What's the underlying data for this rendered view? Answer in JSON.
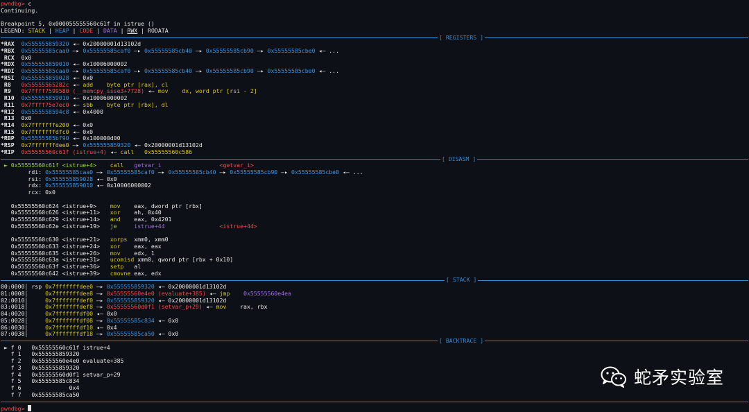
{
  "prompt": "pwndbg>",
  "command": "c",
  "continuing": "Continuing.",
  "breakpoint": "Breakpoint 5, 0x000055555560c61f in istrue ()",
  "legend": {
    "label": "LEGEND:",
    "stack": "STACK",
    "heap": "HEAP",
    "code": "CODE",
    "data": "DATA",
    "rwx": "RWX",
    "rodata": "RODATA"
  },
  "sections": {
    "registers": "[ REGISTERS ]",
    "disasm": "[ DISASM ]",
    "stack": "[ STACK ]",
    "backtrace": "[ BACKTRACE ]"
  },
  "registers": [
    {
      "name": "*RAX",
      "parts": [
        {
          "t": "0x555555859320",
          "c": "blue"
        },
        {
          "t": " ◂— 0x20000001d13102d",
          "c": "white"
        }
      ]
    },
    {
      "name": "*RBX",
      "parts": [
        {
          "t": "0x55555585caa0",
          "c": "blue"
        },
        {
          "t": " —▸ ",
          "c": "white"
        },
        {
          "t": "0x55555585caf0",
          "c": "blue"
        },
        {
          "t": " —▸ ",
          "c": "white"
        },
        {
          "t": "0x55555585cb40",
          "c": "blue"
        },
        {
          "t": " —▸ ",
          "c": "white"
        },
        {
          "t": "0x55555585cb90",
          "c": "blue"
        },
        {
          "t": " —▸ ",
          "c": "white"
        },
        {
          "t": "0x55555585cbe0",
          "c": "blue"
        },
        {
          "t": " ◂— ...",
          "c": "white"
        }
      ]
    },
    {
      "name": " RCX",
      "parts": [
        {
          "t": "0x0",
          "c": "white"
        }
      ]
    },
    {
      "name": "*RDX",
      "parts": [
        {
          "t": "0x555555859010",
          "c": "blue"
        },
        {
          "t": " ◂— 0x10006000002",
          "c": "white"
        }
      ]
    },
    {
      "name": "*RDI",
      "parts": [
        {
          "t": "0x55555585caa0",
          "c": "blue"
        },
        {
          "t": " —▸ ",
          "c": "white"
        },
        {
          "t": "0x55555585caf0",
          "c": "blue"
        },
        {
          "t": " —▸ ",
          "c": "white"
        },
        {
          "t": "0x55555585cb40",
          "c": "blue"
        },
        {
          "t": " —▸ ",
          "c": "white"
        },
        {
          "t": "0x55555585cb90",
          "c": "blue"
        },
        {
          "t": " —▸ ",
          "c": "white"
        },
        {
          "t": "0x55555585cbe0",
          "c": "blue"
        },
        {
          "t": " ◂— ...",
          "c": "white"
        }
      ]
    },
    {
      "name": "*RSI",
      "parts": [
        {
          "t": "0x555555859028",
          "c": "blue"
        },
        {
          "t": " ◂— 0x0",
          "c": "white"
        }
      ]
    },
    {
      "name": " R8 ",
      "parts": [
        {
          "t": "0x55555565282c",
          "c": "red"
        },
        {
          "t": " ◂— ",
          "c": "white"
        },
        {
          "t": "add    byte ptr [rax], cl",
          "c": "yellow"
        }
      ]
    },
    {
      "name": " R9 ",
      "parts": [
        {
          "t": "0x7ffff7599580 (__memcpy_ssse3+7728)",
          "c": "red"
        },
        {
          "t": " ◂— ",
          "c": "white"
        },
        {
          "t": "mov    dx, word ptr [rsi - 2]",
          "c": "yellow"
        }
      ]
    },
    {
      "name": " R10",
      "parts": [
        {
          "t": "0x555555859010",
          "c": "blue"
        },
        {
          "t": " ◂— 0x10006000002",
          "c": "white"
        }
      ]
    },
    {
      "name": " R11",
      "parts": [
        {
          "t": "0x7ffff75e7ec0",
          "c": "red"
        },
        {
          "t": " ◂— ",
          "c": "white"
        },
        {
          "t": "sbb    byte ptr [rbx], dl",
          "c": "yellow"
        }
      ]
    },
    {
      "name": "*R12",
      "parts": [
        {
          "t": "0x5555558594c8",
          "c": "blue"
        },
        {
          "t": " ◂— 0x4000",
          "c": "white"
        }
      ]
    },
    {
      "name": " R13",
      "parts": [
        {
          "t": "0x0",
          "c": "white"
        }
      ]
    },
    {
      "name": "*R14",
      "parts": [
        {
          "t": "0x7fffffffe200",
          "c": "yellow"
        },
        {
          "t": " ◂— 0x0",
          "c": "white"
        }
      ]
    },
    {
      "name": " R15",
      "parts": [
        {
          "t": "0x7fffffffdfc0",
          "c": "yellow"
        },
        {
          "t": " ◂— 0x0",
          "c": "white"
        }
      ]
    },
    {
      "name": "*RBP",
      "parts": [
        {
          "t": "0x55555585bf90",
          "c": "blue"
        },
        {
          "t": " ◂— 0x100000d00",
          "c": "white"
        }
      ]
    },
    {
      "name": "*RSP",
      "parts": [
        {
          "t": "0x7fffffffdee0",
          "c": "yellow"
        },
        {
          "t": " —▸ ",
          "c": "white"
        },
        {
          "t": "0x555555859320",
          "c": "blue"
        },
        {
          "t": " ◂— 0x20000001d13102d",
          "c": "white"
        }
      ]
    },
    {
      "name": "*RIP",
      "parts": [
        {
          "t": "0x55555560c61f (istrue+4)",
          "c": "red"
        },
        {
          "t": " ◂— ",
          "c": "white"
        },
        {
          "t": "call   0x55555560c586",
          "c": "yellow"
        }
      ]
    }
  ],
  "disasm": [
    {
      "parts": [
        {
          "t": " ► 0x55555560c61f <istrue+4>    ",
          "c": "green"
        },
        {
          "t": "call   ",
          "c": "yellow"
        },
        {
          "t": "getvar_i",
          "c": "purple"
        },
        {
          "t": "                 ",
          "c": "white"
        },
        {
          "t": "<getvar_i>",
          "c": "red"
        }
      ]
    },
    {
      "parts": [
        {
          "t": "        rdi: ",
          "c": "white"
        },
        {
          "t": "0x55555585caa0",
          "c": "blue"
        },
        {
          "t": " —▸ ",
          "c": "white"
        },
        {
          "t": "0x55555585caf0",
          "c": "blue"
        },
        {
          "t": " —▸ ",
          "c": "white"
        },
        {
          "t": "0x55555585cb40",
          "c": "blue"
        },
        {
          "t": " —▸ ",
          "c": "white"
        },
        {
          "t": "0x55555585cb90",
          "c": "blue"
        },
        {
          "t": " —▸ ",
          "c": "white"
        },
        {
          "t": "0x55555585cbe0",
          "c": "blue"
        },
        {
          "t": " ◂— ...",
          "c": "white"
        }
      ]
    },
    {
      "parts": [
        {
          "t": "        rsi: ",
          "c": "white"
        },
        {
          "t": "0x555555859028",
          "c": "blue"
        },
        {
          "t": " ◂— 0x0",
          "c": "white"
        }
      ]
    },
    {
      "parts": [
        {
          "t": "        rdx: ",
          "c": "white"
        },
        {
          "t": "0x555555859010",
          "c": "blue"
        },
        {
          "t": " ◂— 0x10006000002",
          "c": "white"
        }
      ]
    },
    {
      "parts": [
        {
          "t": "        rcx: 0x0",
          "c": "white"
        }
      ]
    },
    {
      "parts": [
        {
          "t": " ",
          "c": "white"
        }
      ]
    },
    {
      "parts": [
        {
          "t": "   0x55555560c624 <istrue+9>    ",
          "c": "white"
        },
        {
          "t": "mov    ",
          "c": "yellow"
        },
        {
          "t": "eax, dword ptr [rbx]",
          "c": "white"
        }
      ]
    },
    {
      "parts": [
        {
          "t": "   0x55555560c626 <istrue+11>   ",
          "c": "white"
        },
        {
          "t": "xor    ",
          "c": "yellow"
        },
        {
          "t": "ah, 0x40",
          "c": "white"
        }
      ]
    },
    {
      "parts": [
        {
          "t": "   0x55555560c629 <istrue+14>   ",
          "c": "white"
        },
        {
          "t": "and    ",
          "c": "yellow"
        },
        {
          "t": "eax, 0x4201",
          "c": "white"
        }
      ]
    },
    {
      "parts": [
        {
          "t": "   0x55555560c62e <istrue+19>   ",
          "c": "white"
        },
        {
          "t": "je     ",
          "c": "green"
        },
        {
          "t": "istrue+44",
          "c": "purple"
        },
        {
          "t": "                ",
          "c": "white"
        },
        {
          "t": "<istrue+44>",
          "c": "red"
        }
      ]
    },
    {
      "parts": [
        {
          "t": " ",
          "c": "white"
        }
      ]
    },
    {
      "parts": [
        {
          "t": "   0x55555560c630 <istrue+21>   ",
          "c": "white"
        },
        {
          "t": "xorps  ",
          "c": "yellow"
        },
        {
          "t": "xmm0, xmm0",
          "c": "white"
        }
      ]
    },
    {
      "parts": [
        {
          "t": "   0x55555560c633 <istrue+24>   ",
          "c": "white"
        },
        {
          "t": "xor    ",
          "c": "yellow"
        },
        {
          "t": "eax, eax",
          "c": "white"
        }
      ]
    },
    {
      "parts": [
        {
          "t": "   0x55555560c635 <istrue+26>   ",
          "c": "white"
        },
        {
          "t": "mov    ",
          "c": "yellow"
        },
        {
          "t": "edx, 1",
          "c": "white"
        }
      ]
    },
    {
      "parts": [
        {
          "t": "   0x55555560c63a <istrue+31>   ",
          "c": "white"
        },
        {
          "t": "ucomisd ",
          "c": "yellow"
        },
        {
          "t": "xmm0, qword ptr [rbx + 0x10]",
          "c": "white"
        }
      ]
    },
    {
      "parts": [
        {
          "t": "   0x55555560c63f <istrue+36>   ",
          "c": "white"
        },
        {
          "t": "setp   ",
          "c": "yellow"
        },
        {
          "t": "al",
          "c": "white"
        }
      ]
    },
    {
      "parts": [
        {
          "t": "   0x55555560c642 <istrue+39>   ",
          "c": "white"
        },
        {
          "t": "cmovne ",
          "c": "yellow"
        },
        {
          "t": "eax, edx",
          "c": "white"
        }
      ]
    }
  ],
  "stack": [
    {
      "parts": [
        {
          "t": "00:0000│ ",
          "c": "white"
        },
        {
          "t": "rsp ",
          "c": "white"
        },
        {
          "t": "0x7fffffffdee0",
          "c": "yellow"
        },
        {
          "t": " —▸ ",
          "c": "white"
        },
        {
          "t": "0x555555859320",
          "c": "blue"
        },
        {
          "t": " ◂— 0x20000001d13102d",
          "c": "white"
        }
      ]
    },
    {
      "parts": [
        {
          "t": "01:0008│     ",
          "c": "white"
        },
        {
          "t": "0x7fffffffdee8",
          "c": "yellow"
        },
        {
          "t": " —▸ ",
          "c": "white"
        },
        {
          "t": "0x55555560e4e0 (evaluate+385)",
          "c": "red"
        },
        {
          "t": " ◂— ",
          "c": "white"
        },
        {
          "t": "jmp    ",
          "c": "yellow"
        },
        {
          "t": "0x55555560e4ea",
          "c": "purple"
        }
      ]
    },
    {
      "parts": [
        {
          "t": "02:0010│     ",
          "c": "white"
        },
        {
          "t": "0x7fffffffdef0",
          "c": "yellow"
        },
        {
          "t": " —▸ ",
          "c": "white"
        },
        {
          "t": "0x555555859320",
          "c": "blue"
        },
        {
          "t": " ◂— 0x20000001d13102d",
          "c": "white"
        }
      ]
    },
    {
      "parts": [
        {
          "t": "03:0018│     ",
          "c": "white"
        },
        {
          "t": "0x7fffffffdef8",
          "c": "yellow"
        },
        {
          "t": " —▸ ",
          "c": "white"
        },
        {
          "t": "0x55555560d0f1 (setvar_p+29)",
          "c": "red"
        },
        {
          "t": " ◂— ",
          "c": "white"
        },
        {
          "t": "mov    ",
          "c": "yellow"
        },
        {
          "t": "rax, rbx",
          "c": "white"
        }
      ]
    },
    {
      "parts": [
        {
          "t": "04:0020│     ",
          "c": "white"
        },
        {
          "t": "0x7fffffffdf00",
          "c": "yellow"
        },
        {
          "t": " ◂— 0x0",
          "c": "white"
        }
      ]
    },
    {
      "parts": [
        {
          "t": "05:0028│     ",
          "c": "white"
        },
        {
          "t": "0x7fffffffdf08",
          "c": "yellow"
        },
        {
          "t": " —▸ ",
          "c": "white"
        },
        {
          "t": "0x55555585c834",
          "c": "blue"
        },
        {
          "t": " ◂— 0x0",
          "c": "white"
        }
      ]
    },
    {
      "parts": [
        {
          "t": "06:0030│     ",
          "c": "white"
        },
        {
          "t": "0x7fffffffdf10",
          "c": "yellow"
        },
        {
          "t": " ◂— 0x4",
          "c": "white"
        }
      ]
    },
    {
      "parts": [
        {
          "t": "07:0038│     ",
          "c": "white"
        },
        {
          "t": "0x7fffffffdf18",
          "c": "yellow"
        },
        {
          "t": " —▸ ",
          "c": "white"
        },
        {
          "t": "0x55555585ca50",
          "c": "blue"
        },
        {
          "t": " ◂— 0x0",
          "c": "white"
        }
      ]
    }
  ],
  "backtrace": [
    " ► f 0   0x55555560c61f istrue+4",
    "   f 1   0x555555859320",
    "   f 2   0x55555560e4e0 evaluate+385",
    "   f 3   0x555555859320",
    "   f 4   0x55555560d0f1 setvar_p+29",
    "   f 5   0x55555585c834",
    "   f 6              0x4",
    "   f 7   0x55555585ca50"
  ],
  "watermark": {
    "text": "蛇矛实验室",
    "icon": "wechat-icon"
  }
}
